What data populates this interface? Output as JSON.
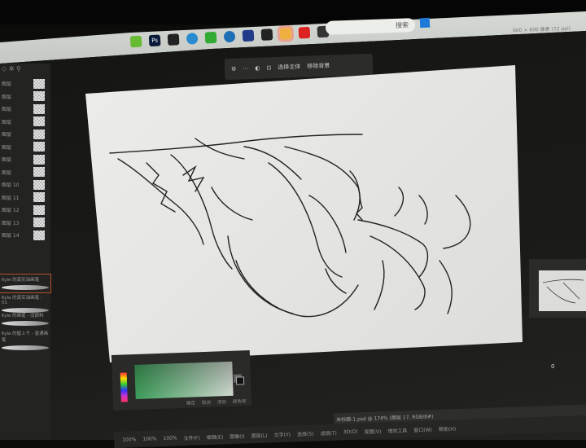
{
  "taskbar": {
    "search_label": "搜索",
    "icons": [
      "app-icon",
      "photoshop-icon",
      "wacom-center-icon",
      "edge-icon",
      "wechat-icon",
      "browser-icon",
      "office-icon",
      "pdf-icon",
      "folder-icon",
      "red-app-icon",
      "window-icon"
    ],
    "window_title": "600 × 600 像素 (72 ppi)"
  },
  "toolbar": {
    "items": [
      "选择主体",
      "移除背景"
    ]
  },
  "layers": [
    "图层",
    "图层",
    "图层",
    "图层",
    "图层",
    "图层",
    "图层",
    "图层",
    "图层 10",
    "图层 11",
    "图层 12",
    "图层 13",
    "图层 14"
  ],
  "brushes": [
    "Kyle 的真实油画笔",
    "Kyle 的真实油画笔 - 01",
    "Kyle 的画笔 - 旧颜料",
    "Kyle 的屋上千 - 普通画笔"
  ],
  "colorpicker": {
    "buttons": [
      "确定",
      "取消",
      "添加",
      "颜色库"
    ],
    "hue_color": "#3d9e5a"
  },
  "status": {
    "doc_tab": "未标题-1.psd @ 174% (图层 17, RGB/8#)",
    "opacity": "100%",
    "flow": "100%",
    "smoothing": "100%",
    "zero": "0"
  },
  "menu": [
    "文件(F)",
    "编辑(E)",
    "图像(I)",
    "图层(L)",
    "文字(Y)",
    "选择(S)",
    "滤镜(T)",
    "3D(D)",
    "视图(V)",
    "增效工具",
    "窗口(W)",
    "帮助(H)"
  ]
}
